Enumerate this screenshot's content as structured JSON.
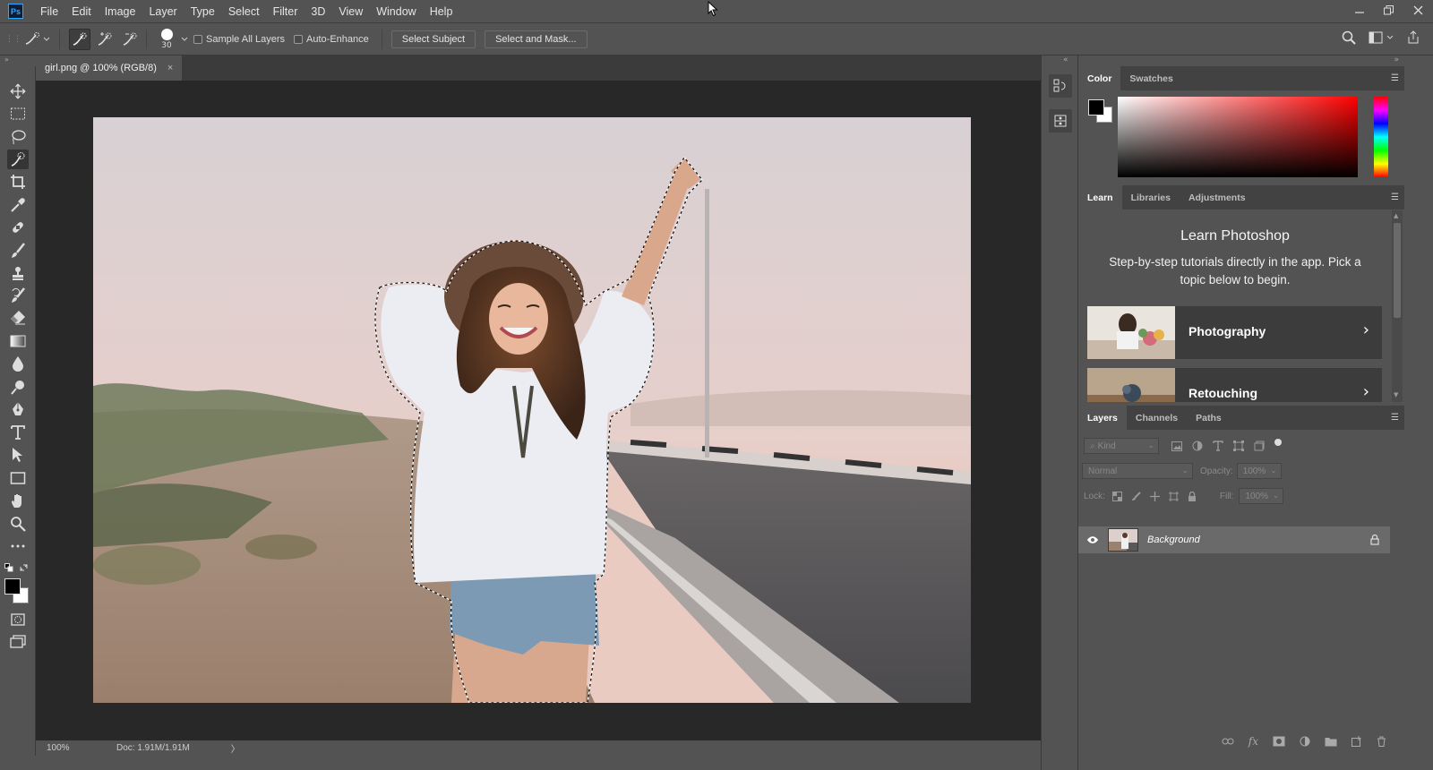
{
  "app": {
    "logo": "Ps",
    "menu": [
      "File",
      "Edit",
      "Image",
      "Layer",
      "Type",
      "Select",
      "Filter",
      "3D",
      "View",
      "Window",
      "Help"
    ],
    "window_controls": [
      "minimize-icon",
      "restore-icon",
      "close-icon"
    ]
  },
  "options": {
    "brush_size": "30",
    "sample_all_layers": "Sample All Layers",
    "auto_enhance": "Auto-Enhance",
    "select_subject": "Select Subject",
    "select_and_mask": "Select and Mask..."
  },
  "document": {
    "tab_title": "girl.png @ 100% (RGB/8)",
    "tab_close": "×"
  },
  "status": {
    "zoom": "100%",
    "doc_size": "Doc: 1.91M/1.91M",
    "arrow": "〉"
  },
  "color_panel": {
    "tabs": [
      "Color",
      "Swatches"
    ],
    "foreground": "#000000",
    "background": "#ffffff",
    "hue_color": "#ff0000"
  },
  "learn_panel": {
    "tabs": [
      "Learn",
      "Libraries",
      "Adjustments"
    ],
    "title": "Learn Photoshop",
    "subtitle": "Step-by-step tutorials directly in the app. Pick a topic below to begin.",
    "cards": [
      "Photography",
      "Retouching"
    ]
  },
  "layers_panel": {
    "tabs": [
      "Layers",
      "Channels",
      "Paths"
    ],
    "kind_placeholder": "Kind",
    "blend_mode": "Normal",
    "opacity_label": "Opacity:",
    "opacity_value": "100%",
    "lock_label": "Lock:",
    "fill_label": "Fill:",
    "fill_value": "100%",
    "layer_name": "Background"
  }
}
